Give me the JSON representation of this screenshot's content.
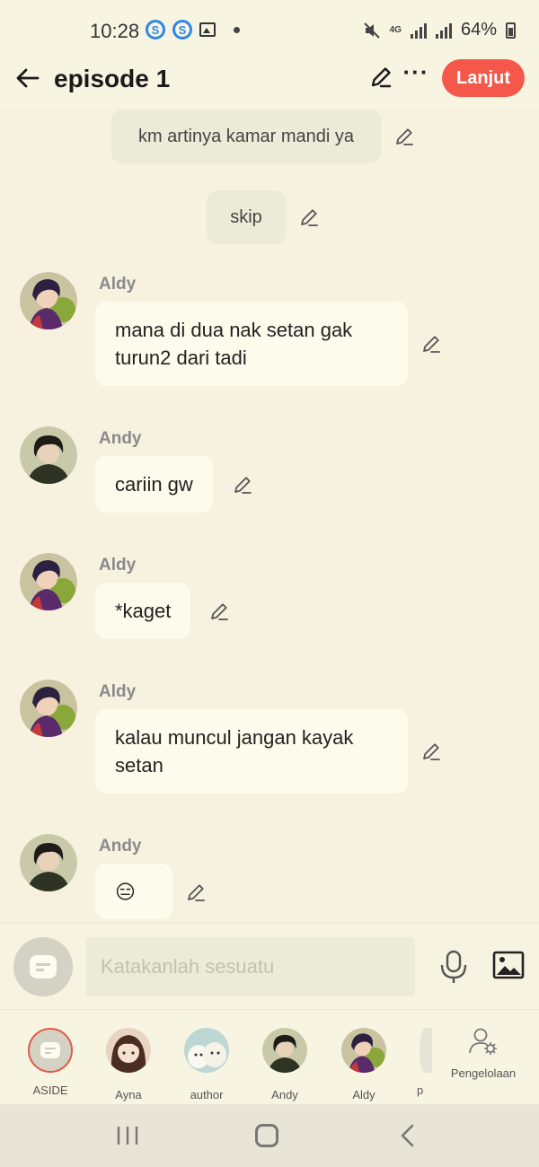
{
  "status": {
    "time": "10:28",
    "network": "4G",
    "battery": "64%"
  },
  "header": {
    "title": "episode 1",
    "next_label": "Lanjut",
    "more_label": "···"
  },
  "messages": [
    {
      "type": "narration",
      "text": "km artinya kamar mandi ya"
    },
    {
      "type": "narration",
      "text": "skip"
    },
    {
      "type": "chat",
      "sender": "Aldy",
      "text": "mana di dua nak setan gak turun2 dari tadi"
    },
    {
      "type": "chat",
      "sender": "Andy",
      "text": "cariin gw"
    },
    {
      "type": "chat",
      "sender": "Aldy",
      "text": "*kaget"
    },
    {
      "type": "chat",
      "sender": "Aldy",
      "text": "kalau muncul jangan kayak setan"
    },
    {
      "type": "chat",
      "sender": "Andy",
      "text": "😑"
    }
  ],
  "input": {
    "placeholder": "Katakanlah sesuatu"
  },
  "characters": [
    {
      "name": "ASIDE"
    },
    {
      "name": "Ayna"
    },
    {
      "name": "author"
    },
    {
      "name": "Andy"
    },
    {
      "name": "Aldy"
    },
    {
      "name": "p"
    }
  ],
  "manage_label": "Pengelolaan",
  "colors": {
    "accent": "#f5584b",
    "background": "#f6f2df",
    "bubble": "#fdfbeb",
    "narration": "#ecebd8"
  }
}
